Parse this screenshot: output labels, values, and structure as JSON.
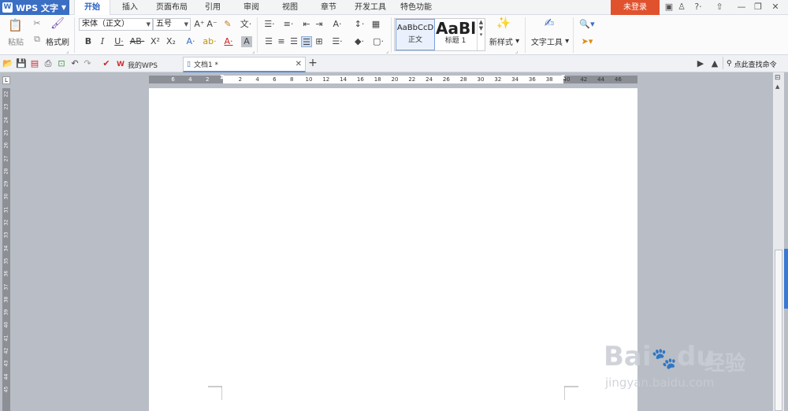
{
  "app": {
    "name": "WPS 文字",
    "logo": "W"
  },
  "menu_tabs": [
    {
      "label": "开始",
      "active": true
    },
    {
      "label": "插入"
    },
    {
      "label": "页面布局"
    },
    {
      "label": "引用"
    },
    {
      "label": "审阅"
    },
    {
      "label": "视图"
    },
    {
      "label": "章节"
    },
    {
      "label": "开发工具"
    },
    {
      "label": "特色功能"
    }
  ],
  "login": "未登录",
  "ribbon": {
    "paste": "粘贴",
    "format_painter": "格式刷",
    "font_name": "宋体（正文）",
    "font_size": "五号",
    "styles": [
      {
        "preview": "AaBbCcD",
        "name": "正文"
      },
      {
        "preview": "AaBl",
        "name": "标题 1"
      }
    ],
    "new_style": "新样式",
    "text_tools": "文字工具"
  },
  "doc_tabs": [
    {
      "label": "我的WPS"
    },
    {
      "label": "文档1 *"
    }
  ],
  "search_cmd": "点此查找命令",
  "ruler": {
    "h_left": [
      "6",
      "4",
      "2"
    ],
    "h_right": [
      "2",
      "4",
      "6",
      "8",
      "10",
      "12",
      "14",
      "16",
      "18",
      "20",
      "22",
      "24",
      "26",
      "28",
      "30",
      "32",
      "34",
      "36",
      "38",
      "40",
      "42",
      "44",
      "46"
    ],
    "v": [
      "22",
      "23",
      "24",
      "25",
      "26",
      "27",
      "28",
      "29",
      "30",
      "31",
      "32",
      "33",
      "34",
      "35",
      "36",
      "37",
      "38",
      "39",
      "40",
      "41",
      "42",
      "43",
      "44",
      "45"
    ]
  },
  "watermark": {
    "brand": "Bai",
    "brand_tail": "du",
    "cn": "经验",
    "url": "jingyan.baidu.com"
  }
}
